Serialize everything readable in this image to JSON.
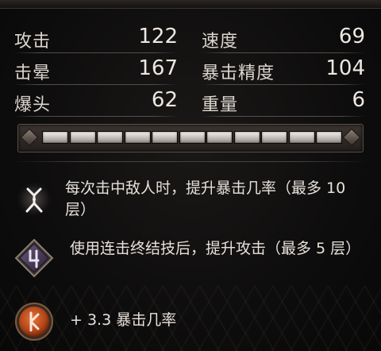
{
  "stats": [
    {
      "label": "攻击",
      "value": "122",
      "label2": "速度",
      "value2": "69"
    },
    {
      "label": "击晕",
      "value": "167",
      "label2": "暴击精度",
      "value2": "104"
    },
    {
      "label": "爆头",
      "value": "62",
      "label2": "重量",
      "value2": "6"
    }
  ],
  "gauge": {
    "filled_segments": 11,
    "total_segments": 11
  },
  "perks": [
    {
      "icon": "white-rune-icon",
      "text": "每次击中敌人时，提升暴击几率（最多 10 层）"
    },
    {
      "icon": "purple-diamond-rune-icon",
      "text": "使用连击终结技后，提升攻击（最多 5 层）"
    },
    {
      "icon": "orange-circle-rune-icon",
      "text": "+ 3.3 暴击几率"
    }
  ],
  "colors": {
    "background": "#0c0b0b",
    "text": "#e4ded8",
    "segment": "#f4f1ee",
    "perk_purple": "#4a3a5e",
    "perk_orange": "#c0501e"
  }
}
